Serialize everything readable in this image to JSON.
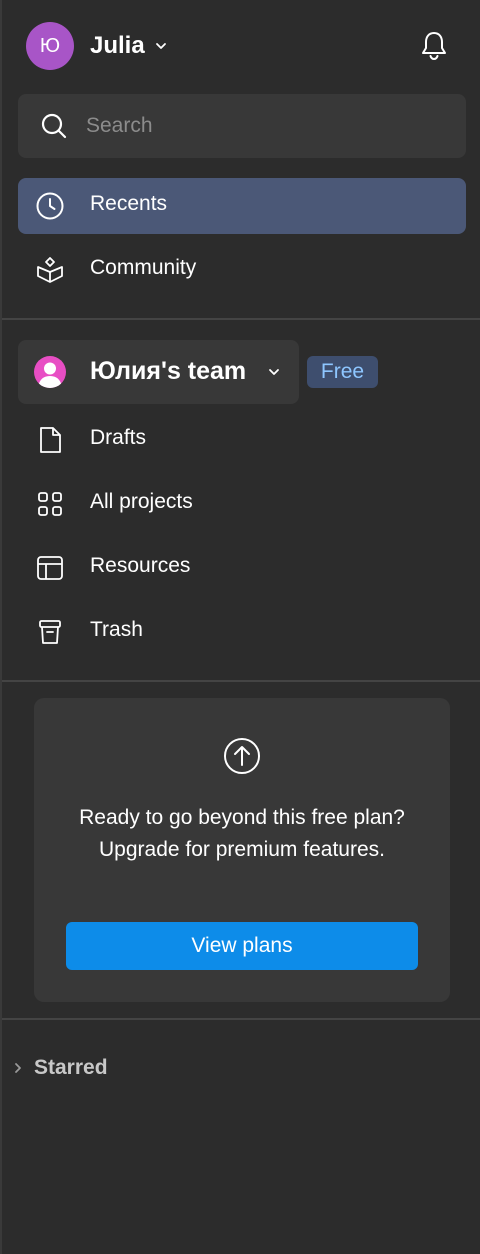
{
  "user": {
    "avatar_initial": "Ю",
    "name": "Julia"
  },
  "search": {
    "placeholder": "Search"
  },
  "nav_top": [
    {
      "label": "Recents",
      "icon": "clock-icon",
      "active": true
    },
    {
      "label": "Community",
      "icon": "community-icon",
      "active": false
    }
  ],
  "team": {
    "name": "Юлия's team",
    "plan_badge": "Free"
  },
  "nav_team": [
    {
      "label": "Drafts",
      "icon": "file-icon"
    },
    {
      "label": "All projects",
      "icon": "grid-icon"
    },
    {
      "label": "Resources",
      "icon": "layout-icon"
    },
    {
      "label": "Trash",
      "icon": "trash-icon"
    }
  ],
  "upgrade": {
    "text": "Ready to go beyond this free plan? Upgrade for premium features.",
    "button_label": "View plans"
  },
  "starred": {
    "label": "Starred"
  },
  "colors": {
    "background": "#2c2c2c",
    "active_item": "#4b5877",
    "primary_button": "#0d8ce9",
    "badge_text": "#8ec6ff",
    "avatar": "#a855c7"
  }
}
